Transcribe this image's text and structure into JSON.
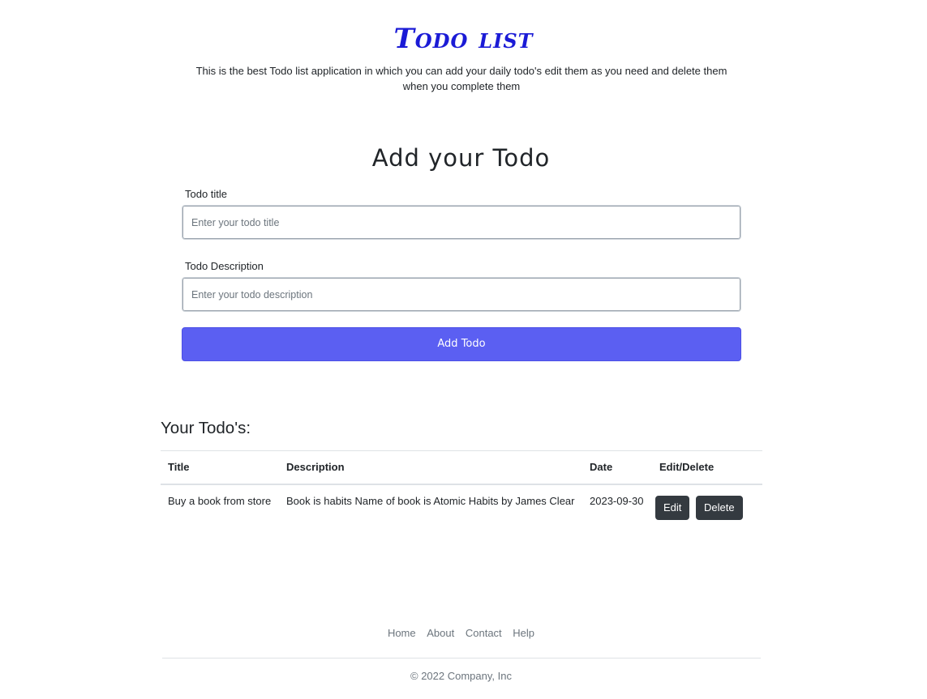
{
  "header": {
    "title": "Todo list",
    "description": "This is the best Todo list application in which you can add your daily todo's edit them as you need and delete them when you complete them"
  },
  "form": {
    "heading": "Add your Todo",
    "title_label": "Todo title",
    "title_placeholder": "Enter your todo title",
    "title_value": "",
    "desc_label": "Todo Description",
    "desc_placeholder": "Enter your todo description",
    "desc_value": "",
    "submit_label": "Add Todo"
  },
  "todos": {
    "heading": "Your Todo's:",
    "columns": [
      "Title",
      "Description",
      "Date",
      "Edit/Delete"
    ],
    "rows": [
      {
        "title": "Buy a book from store",
        "description": "Book is habits Name of book is Atomic Habits by James Clear",
        "date": "2023-09-30",
        "edit_label": "Edit",
        "delete_label": "Delete"
      }
    ]
  },
  "footer": {
    "links": [
      "Home",
      "About",
      "Contact",
      "Help"
    ],
    "copyright": "© 2022 Company, Inc"
  },
  "colors": {
    "accent": "#5b5ff2",
    "title": "#1b1bd6",
    "dark_button": "#343a40"
  }
}
